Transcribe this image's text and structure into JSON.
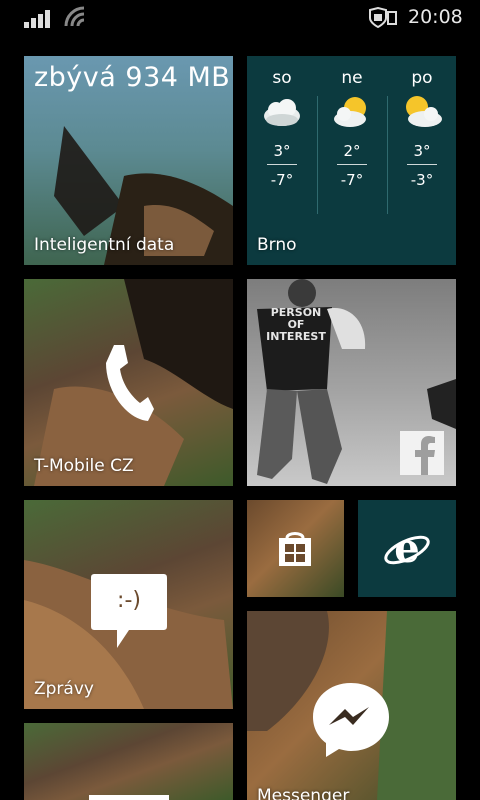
{
  "status_bar": {
    "time": "20:08",
    "icons": [
      "signal-icon",
      "wifi-icon",
      "shield-battery-icon"
    ]
  },
  "tiles": {
    "data_sense": {
      "headline": "zbývá 934 MB",
      "label": "Inteligentní data"
    },
    "weather": {
      "label": "Brno",
      "days": [
        {
          "day": "so",
          "high": "3°",
          "low": "-7°",
          "icon": "cloudy-icon"
        },
        {
          "day": "ne",
          "high": "2°",
          "low": "-7°",
          "icon": "partly-sunny-icon"
        },
        {
          "day": "po",
          "high": "3°",
          "low": "-3°",
          "icon": "partly-sunny-icon"
        }
      ]
    },
    "phone": {
      "label": "T-Mobile CZ",
      "icon": "phone-icon"
    },
    "people": {
      "photo_text": "PERSON OF INTEREST",
      "icon": "facebook-icon"
    },
    "store": {
      "icon": "store-icon"
    },
    "ie": {
      "icon": "internet-explorer-icon"
    },
    "messaging": {
      "label": "Zprávy",
      "emoticon": ":-)",
      "icon": "messaging-icon"
    },
    "messenger": {
      "label": "Messenger",
      "icon": "messenger-icon"
    }
  }
}
